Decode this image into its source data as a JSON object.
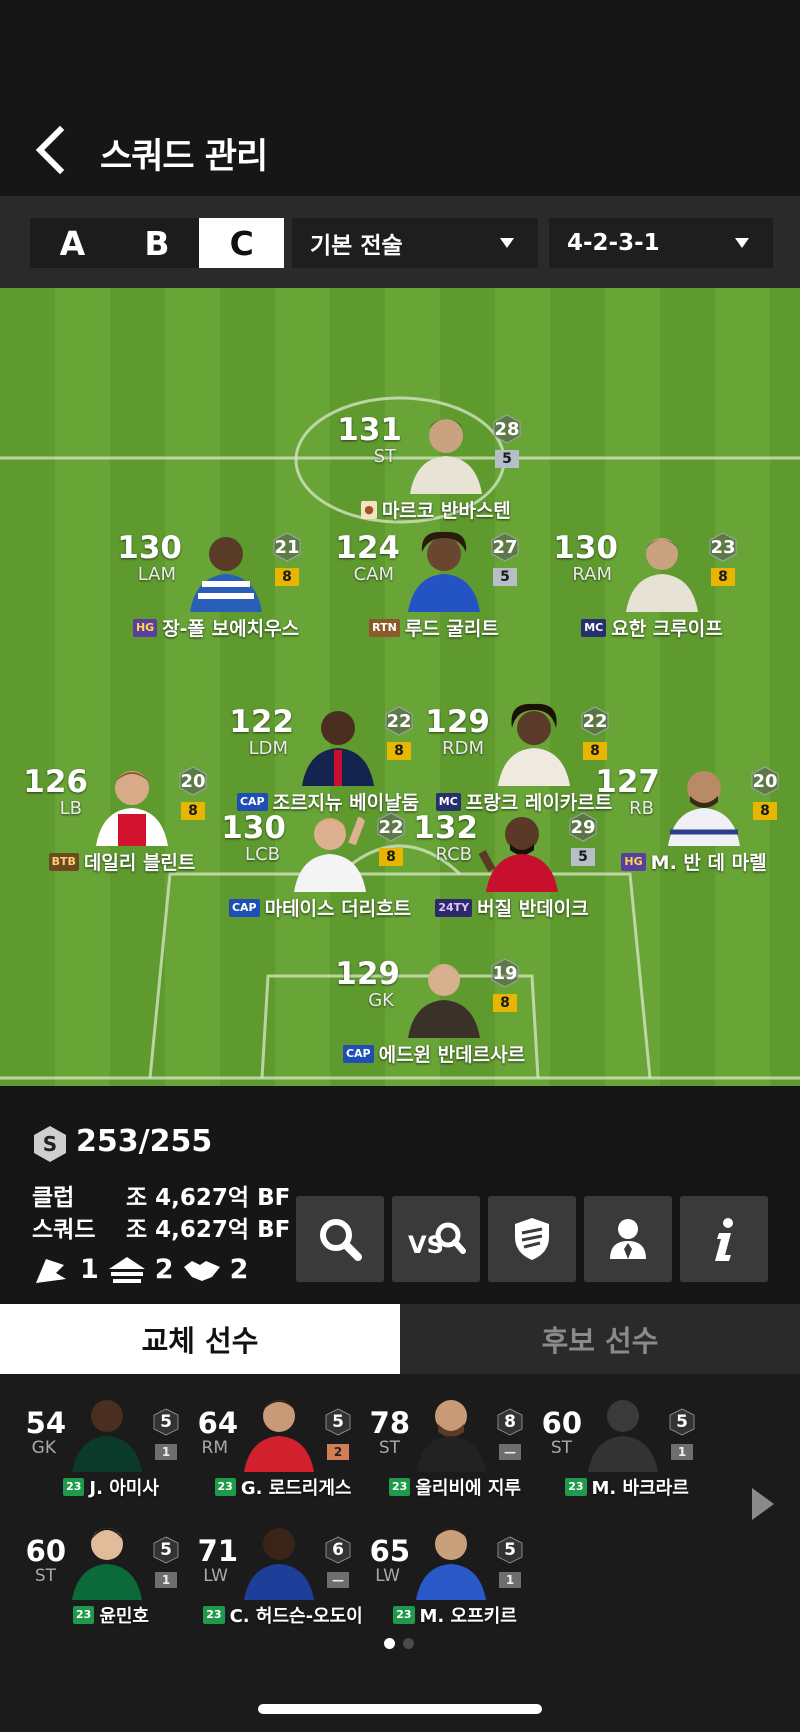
{
  "header": {
    "title": "스쿼드 관리"
  },
  "squad_tabs": [
    {
      "label": "A",
      "active": false
    },
    {
      "label": "B",
      "active": false
    },
    {
      "label": "C",
      "active": true
    }
  ],
  "tactic_dropdown": {
    "value": "기본 전술"
  },
  "formation_dropdown": {
    "value": "4-2-3-1"
  },
  "players": [
    {
      "ovr": "131",
      "pos": "ST",
      "hex": "28",
      "grade": "5",
      "grade_color": "silver",
      "badge": "",
      "badge_color": "#d8c08a",
      "name": "마르코 반바스텐"
    },
    {
      "ovr": "130",
      "pos": "LAM",
      "hex": "21",
      "grade": "8",
      "grade_color": "gold",
      "badge": "HG",
      "badge_color": "#5b3fa0",
      "name": "장-폴 보에치우스"
    },
    {
      "ovr": "124",
      "pos": "CAM",
      "hex": "27",
      "grade": "5",
      "grade_color": "silver",
      "badge": "RTN",
      "badge_color": "#8a5a2a",
      "name": "루드 굴리트"
    },
    {
      "ovr": "130",
      "pos": "RAM",
      "hex": "23",
      "grade": "8",
      "grade_color": "gold",
      "badge": "MC",
      "badge_color": "#27306e",
      "name": "요한 크루이프"
    },
    {
      "ovr": "122",
      "pos": "LDM",
      "hex": "22",
      "grade": "8",
      "grade_color": "gold",
      "badge": "CAP",
      "badge_color": "#1f4fb4",
      "name": "조르지뉴 베이날둠"
    },
    {
      "ovr": "129",
      "pos": "RDM",
      "hex": "22",
      "grade": "8",
      "grade_color": "gold",
      "badge": "MC",
      "badge_color": "#27306e",
      "name": "프랑크 레이카르트"
    },
    {
      "ovr": "126",
      "pos": "LB",
      "hex": "20",
      "grade": "8",
      "grade_color": "gold",
      "badge": "BTB",
      "badge_color": "#6a4a20",
      "name": "데일리 블린트"
    },
    {
      "ovr": "127",
      "pos": "RB",
      "hex": "20",
      "grade": "8",
      "grade_color": "gold",
      "badge": "HG",
      "badge_color": "#5b3fa0",
      "name": "M. 반 데 마렐"
    },
    {
      "ovr": "130",
      "pos": "LCB",
      "hex": "22",
      "grade": "8",
      "grade_color": "gold",
      "badge": "CAP",
      "badge_color": "#1f4fb4",
      "name": "마테이스 더리흐트"
    },
    {
      "ovr": "132",
      "pos": "RCB",
      "hex": "29",
      "grade": "5",
      "grade_color": "silver",
      "badge": "24TY",
      "badge_color": "#2b2b6b",
      "name": "버질 반데이크"
    },
    {
      "ovr": "129",
      "pos": "GK",
      "hex": "19",
      "grade": "8",
      "grade_color": "gold",
      "badge": "CAP",
      "badge_color": "#1f4fb4",
      "name": "에드윈 반데르사르"
    }
  ],
  "stats": {
    "salary": "253/255",
    "club_label": "클럽",
    "club_value": "조 4,627억 BF",
    "squad_label": "스쿼드",
    "squad_value": "조 4,627억 BF",
    "chem_a": "1",
    "chem_b": "2",
    "chem_c": "2"
  },
  "tool_icons": [
    "search-icon",
    "vs-compare-icon",
    "shield-icon",
    "manager-icon",
    "info-icon"
  ],
  "subtabs": {
    "sub": "교체 선수",
    "reserve": "후보 선수"
  },
  "bench": [
    {
      "ovr": "54",
      "pos": "GK",
      "hex": "5",
      "grade": "1",
      "grade_color": "gray",
      "badge": "23",
      "name": "J. 아미사"
    },
    {
      "ovr": "64",
      "pos": "RM",
      "hex": "5",
      "grade": "2",
      "grade_color": "bronze",
      "badge": "23",
      "name": "G. 로드리게스"
    },
    {
      "ovr": "78",
      "pos": "ST",
      "hex": "8",
      "grade": "—",
      "grade_color": "gray",
      "badge": "23",
      "name": "올리비에 지루"
    },
    {
      "ovr": "60",
      "pos": "ST",
      "hex": "5",
      "grade": "1",
      "grade_color": "gray",
      "badge": "23",
      "name": "M. 바크라르"
    },
    {
      "ovr": "60",
      "pos": "ST",
      "hex": "5",
      "grade": "1",
      "grade_color": "gray",
      "badge": "23",
      "name": "윤민호"
    },
    {
      "ovr": "71",
      "pos": "LW",
      "hex": "6",
      "grade": "—",
      "grade_color": "gray",
      "badge": "23",
      "name": "C. 허드슨-오도이"
    },
    {
      "ovr": "65",
      "pos": "LW",
      "hex": "5",
      "grade": "1",
      "grade_color": "gray",
      "badge": "23",
      "name": "M. 오프키르"
    }
  ],
  "pager": {
    "pages": 2,
    "current": 1
  }
}
